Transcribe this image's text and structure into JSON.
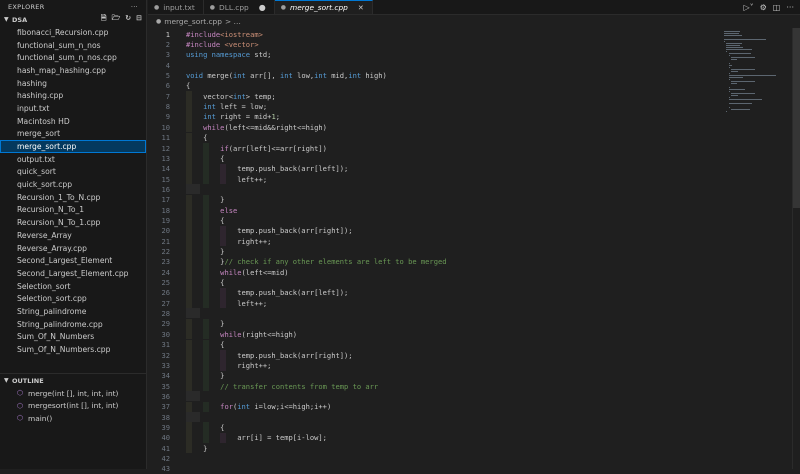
{
  "explorer": {
    "title": "EXPLORER",
    "more": "···"
  },
  "folder": {
    "name": "DSA"
  },
  "files": [
    {
      "name": "fibonacci_Recursion.cpp",
      "type": "file"
    },
    {
      "name": "functional_sum_n_nos",
      "type": "file"
    },
    {
      "name": "functional_sum_n_nos.cpp",
      "type": "file"
    },
    {
      "name": "hash_map_hashing.cpp",
      "type": "file"
    },
    {
      "name": "hashing",
      "type": "file"
    },
    {
      "name": "hashing.cpp",
      "type": "file"
    },
    {
      "name": "input.txt",
      "type": "file"
    },
    {
      "name": "Macintosh HD",
      "type": "file"
    },
    {
      "name": "merge_sort",
      "type": "file"
    },
    {
      "name": "merge_sort.cpp",
      "type": "file",
      "selected": true
    },
    {
      "name": "output.txt",
      "type": "file"
    },
    {
      "name": "quick_sort",
      "type": "file"
    },
    {
      "name": "quick_sort.cpp",
      "type": "file"
    },
    {
      "name": "Recursion_1_To_N.cpp",
      "type": "file"
    },
    {
      "name": "Recursion_N_To_1",
      "type": "file"
    },
    {
      "name": "Recursion_N_To_1.cpp",
      "type": "file"
    },
    {
      "name": "Reverse_Array",
      "type": "file"
    },
    {
      "name": "Reverse_Array.cpp",
      "type": "file"
    },
    {
      "name": "Second_Largest_Element",
      "type": "file"
    },
    {
      "name": "Second_Largest_Element.cpp",
      "type": "file"
    },
    {
      "name": "Selection_sort",
      "type": "file"
    },
    {
      "name": "Selection_sort.cpp",
      "type": "file"
    },
    {
      "name": "String_palindrome",
      "type": "file"
    },
    {
      "name": "String_palindrome.cpp",
      "type": "file"
    },
    {
      "name": "Sum_Of_N_Numbers",
      "type": "file"
    },
    {
      "name": "Sum_Of_N_Numbers.cpp",
      "type": "file"
    }
  ],
  "outline": {
    "title": "OUTLINE",
    "items": [
      {
        "label": "merge(int [], int, int, int)"
      },
      {
        "label": "mergesort(int [], int, int)"
      },
      {
        "label": "main()"
      }
    ]
  },
  "tabs": [
    {
      "label": "input.txt",
      "active": false,
      "dirty": false
    },
    {
      "label": "DLL.cpp",
      "active": false,
      "dirty": true
    },
    {
      "label": "merge_sort.cpp",
      "active": true,
      "dirty": false
    }
  ],
  "breadcrumb": {
    "file": "merge_sort.cpp",
    "sep": "> …"
  },
  "editor": {
    "current_line": 1,
    "lines": [
      {
        "n": 1,
        "segs": [
          [
            "kw2",
            "#include"
          ],
          [
            "str",
            "<iostream>"
          ]
        ]
      },
      {
        "n": 2,
        "segs": [
          [
            "kw2",
            "#include"
          ],
          [
            "str",
            " <vector>"
          ]
        ]
      },
      {
        "n": 3,
        "segs": [
          [
            "kw",
            "using"
          ],
          [
            "",
            " "
          ],
          [
            "kw",
            "namespace"
          ],
          [
            "",
            " std;"
          ]
        ]
      },
      {
        "n": 4,
        "segs": []
      },
      {
        "n": 5,
        "segs": [
          [
            "kw",
            "void"
          ],
          [
            "",
            " merge("
          ],
          [
            "kw",
            "int"
          ],
          [
            "",
            " arr[], "
          ],
          [
            "kw",
            "int"
          ],
          [
            "",
            " low,"
          ],
          [
            "kw",
            "int"
          ],
          [
            "",
            " mid,"
          ],
          [
            "kw",
            "int"
          ],
          [
            "",
            " high)"
          ]
        ]
      },
      {
        "n": 6,
        "segs": [
          [
            "",
            "{"
          ]
        ]
      },
      {
        "n": 7,
        "segs": [
          [
            "",
            "    vector<"
          ],
          [
            "kw",
            "int"
          ],
          [
            "",
            "> temp;"
          ]
        ]
      },
      {
        "n": 8,
        "segs": [
          [
            "",
            "    "
          ],
          [
            "kw",
            "int"
          ],
          [
            "",
            " left = low;"
          ]
        ]
      },
      {
        "n": 9,
        "segs": [
          [
            "",
            "    "
          ],
          [
            "kw",
            "int"
          ],
          [
            "",
            " right = mid+"
          ],
          [
            "num",
            "1"
          ],
          [
            "",
            ";"
          ]
        ]
      },
      {
        "n": 10,
        "segs": [
          [
            "",
            "    "
          ],
          [
            "kw2",
            "while"
          ],
          [
            "",
            "(left<=mid&&right<=high)"
          ]
        ]
      },
      {
        "n": 11,
        "segs": [
          [
            "",
            "    {"
          ]
        ]
      },
      {
        "n": 12,
        "segs": [
          [
            "",
            "        "
          ],
          [
            "kw2",
            "if"
          ],
          [
            "",
            "(arr[left]<=arr[right])"
          ]
        ]
      },
      {
        "n": 13,
        "segs": [
          [
            "",
            "        {"
          ]
        ]
      },
      {
        "n": 14,
        "segs": [
          [
            "",
            "            temp.push_back(arr[left]);"
          ]
        ]
      },
      {
        "n": 15,
        "segs": [
          [
            "",
            "            left++;"
          ]
        ]
      },
      {
        "n": 16,
        "segs": []
      },
      {
        "n": 17,
        "segs": [
          [
            "",
            "        }"
          ]
        ]
      },
      {
        "n": 18,
        "segs": [
          [
            "",
            "        "
          ],
          [
            "kw2",
            "else"
          ]
        ]
      },
      {
        "n": 19,
        "segs": [
          [
            "",
            "        {"
          ]
        ]
      },
      {
        "n": 20,
        "segs": [
          [
            "",
            "            temp.push_back(arr[right]);"
          ]
        ]
      },
      {
        "n": 21,
        "segs": [
          [
            "",
            "            right++;"
          ]
        ]
      },
      {
        "n": 22,
        "segs": [
          [
            "",
            "        }"
          ]
        ]
      },
      {
        "n": 23,
        "segs": [
          [
            "",
            "        }"
          ],
          [
            "com",
            "// check if any other elements are left to be merged"
          ]
        ]
      },
      {
        "n": 24,
        "segs": [
          [
            "",
            "        "
          ],
          [
            "kw2",
            "while"
          ],
          [
            "",
            "(left<=mid)"
          ]
        ]
      },
      {
        "n": 25,
        "segs": [
          [
            "",
            "        {"
          ]
        ]
      },
      {
        "n": 26,
        "segs": [
          [
            "",
            "            temp.push_back(arr[left]);"
          ]
        ]
      },
      {
        "n": 27,
        "segs": [
          [
            "",
            "            left++;"
          ]
        ]
      },
      {
        "n": 28,
        "segs": []
      },
      {
        "n": 29,
        "segs": [
          [
            "",
            "        }"
          ]
        ]
      },
      {
        "n": 30,
        "segs": [
          [
            "",
            "        "
          ],
          [
            "kw2",
            "while"
          ],
          [
            "",
            "(right<=high)"
          ]
        ]
      },
      {
        "n": 31,
        "segs": [
          [
            "",
            "        {"
          ]
        ]
      },
      {
        "n": 32,
        "segs": [
          [
            "",
            "            temp.push_back(arr[right]);"
          ]
        ]
      },
      {
        "n": 33,
        "segs": [
          [
            "",
            "            right++;"
          ]
        ]
      },
      {
        "n": 34,
        "segs": [
          [
            "",
            "        }"
          ]
        ]
      },
      {
        "n": 35,
        "segs": [
          [
            "",
            "        "
          ],
          [
            "com",
            "// transfer contents from temp to arr"
          ]
        ]
      },
      {
        "n": 36,
        "segs": []
      },
      {
        "n": 37,
        "segs": [
          [
            "",
            "        "
          ],
          [
            "kw2",
            "for"
          ],
          [
            "",
            "("
          ],
          [
            "kw",
            "int"
          ],
          [
            "",
            " i=low;i<=high;i++)"
          ]
        ]
      },
      {
        "n": 38,
        "segs": []
      },
      {
        "n": 39,
        "segs": [
          [
            "",
            "        {"
          ]
        ]
      },
      {
        "n": 40,
        "segs": [
          [
            "",
            "            arr[i] = temp[i-low];"
          ]
        ]
      },
      {
        "n": 41,
        "segs": [
          [
            "",
            "    }"
          ]
        ]
      },
      {
        "n": 42,
        "segs": []
      },
      {
        "n": 43,
        "segs": []
      }
    ]
  }
}
